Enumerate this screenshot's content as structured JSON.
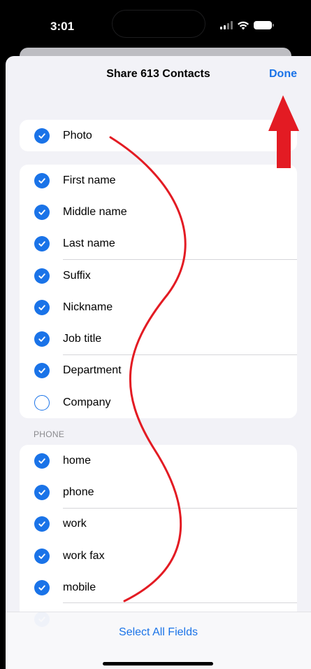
{
  "status_bar": {
    "time": "3:01"
  },
  "sheet": {
    "title": "Share 613 Contacts",
    "done_label": "Done"
  },
  "photo_group": [
    {
      "label": "Photo",
      "checked": true
    }
  ],
  "name_group": [
    {
      "label": "First name",
      "checked": true
    },
    {
      "label": "Middle name",
      "checked": true
    },
    {
      "label": "Last name",
      "checked": true
    },
    {
      "label": "Suffix",
      "checked": true
    },
    {
      "label": "Nickname",
      "checked": true
    },
    {
      "label": "Job title",
      "checked": true
    },
    {
      "label": "Department",
      "checked": true
    },
    {
      "label": "Company",
      "checked": false
    }
  ],
  "phone_section": {
    "header": "PHONE",
    "items": [
      {
        "label": "home",
        "checked": true
      },
      {
        "label": "phone",
        "checked": true
      },
      {
        "label": "work",
        "checked": true
      },
      {
        "label": "work fax",
        "checked": true
      },
      {
        "label": "mobile",
        "checked": true
      }
    ]
  },
  "bottom": {
    "select_all_label": "Select All Fields"
  },
  "colors": {
    "accent": "#1a73e8",
    "annotation": "#e31b23"
  }
}
